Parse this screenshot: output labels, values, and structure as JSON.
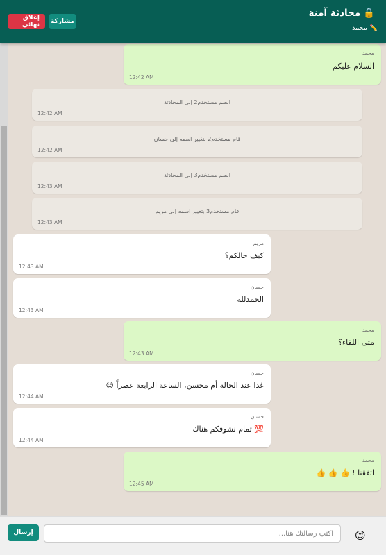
{
  "header": {
    "title": "محادثة آمنة",
    "lock_icon": "🔒",
    "user_name": "محمد",
    "pencil_icon": "✏️",
    "share_label": "مشاركة",
    "close_label": "إغلاق نهائي"
  },
  "messages": [
    {
      "kind": "own",
      "sender": "محمد",
      "text": "السلام عليكم",
      "time": "12:42 AM"
    },
    {
      "kind": "system",
      "text": "انضم مستخدم2 إلى المحادثة",
      "time": "12:42 AM"
    },
    {
      "kind": "system",
      "text": "قام مستخدم2 بتغيير اسمه إلى حسان",
      "time": "12:42 AM"
    },
    {
      "kind": "system",
      "text": "انضم مستخدم3 إلى المحادثة",
      "time": "12:43 AM"
    },
    {
      "kind": "system",
      "text": "قام مستخدم3 بتغيير اسمه إلى مريم",
      "time": "12:43 AM"
    },
    {
      "kind": "other",
      "sender": "مريم",
      "text": "كيف حالكم؟",
      "time": "12:43 AM"
    },
    {
      "kind": "other",
      "sender": "حسان",
      "text": "الحمدلله",
      "time": "12:43 AM"
    },
    {
      "kind": "own",
      "sender": "محمد",
      "text": "متى اللقاء؟",
      "time": "12:43 AM"
    },
    {
      "kind": "other",
      "sender": "حسان",
      "text": "غدا عند الخالة أم محسن، الساعة الرابعة عصراً 😉",
      "time": "12:44 AM"
    },
    {
      "kind": "other",
      "sender": "حسان",
      "text": "💯 تمام نشوفكم هناك",
      "time": "12:44 AM"
    },
    {
      "kind": "own",
      "sender": "محمد",
      "text": "اتفقنا ! 👍 👍 👍",
      "time": "12:45 AM"
    }
  ],
  "composer": {
    "placeholder": "اكتب رسالتك هنا...",
    "send_label": "إرسال",
    "emoji_icon": "😊"
  },
  "colors": {
    "header": "#075e54",
    "accent": "#128c7e",
    "danger": "#dc3545",
    "own_bubble": "#dcf8c6",
    "other_bubble": "#ffffff",
    "system_bubble": "#ece8e2",
    "background": "#e5ddd5"
  }
}
